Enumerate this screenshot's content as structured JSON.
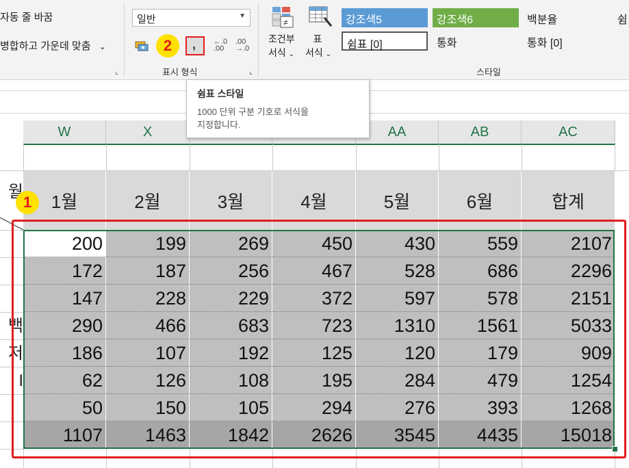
{
  "ribbon": {
    "alignment": {
      "wrap_text": "자동 줄 바꿈",
      "merge_center": "병합하고 가운데 맞춤",
      "merge_arrow": "⌄"
    },
    "number": {
      "format_value": "일반",
      "group_label": "표시 형식",
      "comma_label": ",",
      "inc_decimal": "←.0 .00",
      "dec_decimal": ".00 →.0"
    },
    "styles": {
      "conditional_line1": "조건부",
      "conditional_line2": "서식",
      "table_line1": "표",
      "table_line2": "서식",
      "group_label": "스타일",
      "cells": [
        {
          "label": "강조색5",
          "bg": "#5b9bd5",
          "fg": "#ffffff"
        },
        {
          "label": "강조색6",
          "bg": "#70ad47",
          "fg": "#ffffff"
        },
        {
          "label": "백분율",
          "bg": "#f3f3f3",
          "fg": "#222222"
        },
        {
          "label": "쉼",
          "bg": "#f3f3f3",
          "fg": "#222222"
        },
        {
          "label": "쉼표 [0]",
          "bg": "#ffffff",
          "fg": "#222222"
        },
        {
          "label": "통화",
          "bg": "#f3f3f3",
          "fg": "#222222"
        },
        {
          "label": "통화 [0]",
          "bg": "#f3f3f3",
          "fg": "#222222"
        }
      ]
    }
  },
  "tooltip": {
    "title": "쉼표 스타일",
    "body_line1": "1000 단위 구분 기호로 서식을",
    "body_line2": "지정합니다."
  },
  "columns": [
    "W",
    "X",
    "",
    "",
    "AA",
    "AB",
    "AC"
  ],
  "header_row": [
    "1월",
    "2월",
    "3월",
    "4월",
    "5월",
    "6월",
    "합계"
  ],
  "row_labels_partial": [
    "월",
    "",
    "",
    "",
    "백",
    "저",
    "I",
    "",
    ""
  ],
  "rows": [
    [
      200,
      199,
      269,
      450,
      430,
      559,
      2107
    ],
    [
      172,
      187,
      256,
      467,
      528,
      686,
      2296
    ],
    [
      147,
      228,
      229,
      372,
      597,
      578,
      2151
    ],
    [
      290,
      466,
      683,
      723,
      1310,
      1561,
      5033
    ],
    [
      186,
      107,
      192,
      125,
      120,
      179,
      909
    ],
    [
      62,
      126,
      108,
      195,
      284,
      479,
      1254
    ],
    [
      50,
      150,
      105,
      294,
      276,
      393,
      1268
    ],
    [
      1107,
      1463,
      1842,
      2626,
      3545,
      4435,
      15018
    ]
  ],
  "badges": [
    "1",
    "2"
  ],
  "colors": {
    "selection": "#217346",
    "highlight_red": "#e21d1d",
    "badge_yellow": "#ffe100",
    "cell_gray": "#bfbfbf",
    "total_gray": "#a6a6a6",
    "header_gray": "#d9d9d9"
  }
}
